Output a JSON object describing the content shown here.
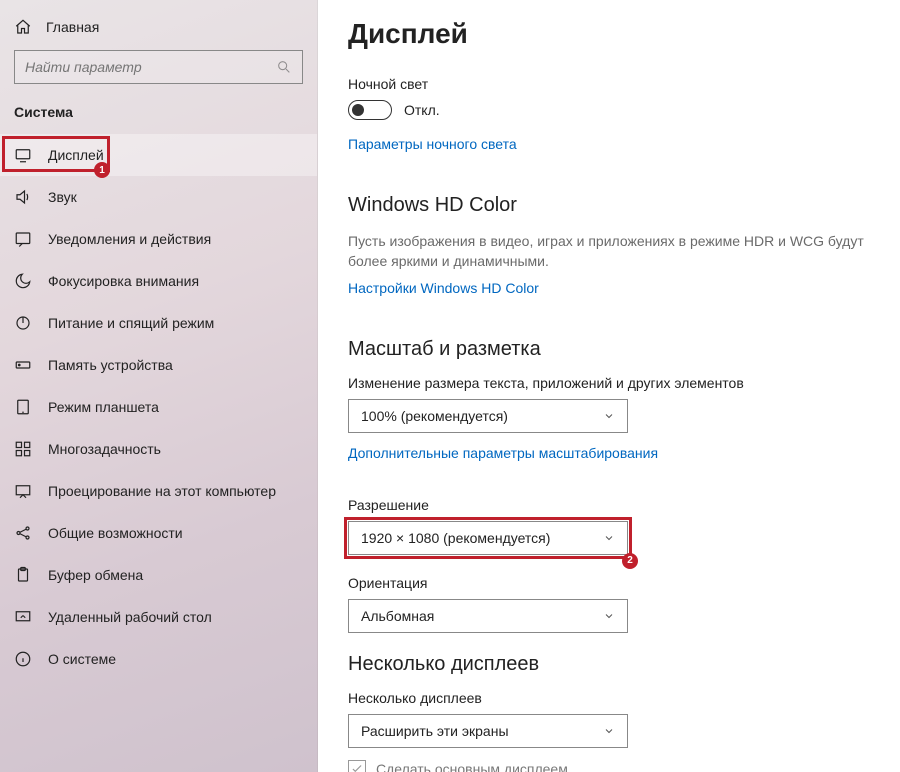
{
  "sidebar": {
    "home": "Главная",
    "search_placeholder": "Найти параметр",
    "section": "Система",
    "items": [
      {
        "label": "Дисплей"
      },
      {
        "label": "Звук"
      },
      {
        "label": "Уведомления и действия"
      },
      {
        "label": "Фокусировка внимания"
      },
      {
        "label": "Питание и спящий режим"
      },
      {
        "label": "Память устройства"
      },
      {
        "label": "Режим планшета"
      },
      {
        "label": "Многозадачность"
      },
      {
        "label": "Проецирование на этот компьютер"
      },
      {
        "label": "Общие возможности"
      },
      {
        "label": "Буфер обмена"
      },
      {
        "label": "Удаленный рабочий стол"
      },
      {
        "label": "О системе"
      }
    ]
  },
  "main": {
    "title": "Дисплей",
    "night_light_label": "Ночной свет",
    "night_light_state": "Откл.",
    "night_light_settings_link": "Параметры ночного света",
    "hd_color_heading": "Windows HD Color",
    "hd_color_desc": "Пусть изображения в видео, играх и приложениях в режиме HDR и WCG будут более яркими и динамичными.",
    "hd_color_link": "Настройки Windows HD Color",
    "scale_heading": "Масштаб и разметка",
    "scale_label": "Изменение размера текста, приложений и других элементов",
    "scale_value": "100% (рекомендуется)",
    "scale_advanced_link": "Дополнительные параметры масштабирования",
    "resolution_label": "Разрешение",
    "resolution_value": "1920 × 1080 (рекомендуется)",
    "orientation_label": "Ориентация",
    "orientation_value": "Альбомная",
    "multi_heading": "Несколько дисплеев",
    "multi_label": "Несколько дисплеев",
    "multi_value": "Расширить эти экраны",
    "primary_checkbox": "Сделать основным дисплеем"
  },
  "markers": {
    "one": "1",
    "two": "2"
  }
}
